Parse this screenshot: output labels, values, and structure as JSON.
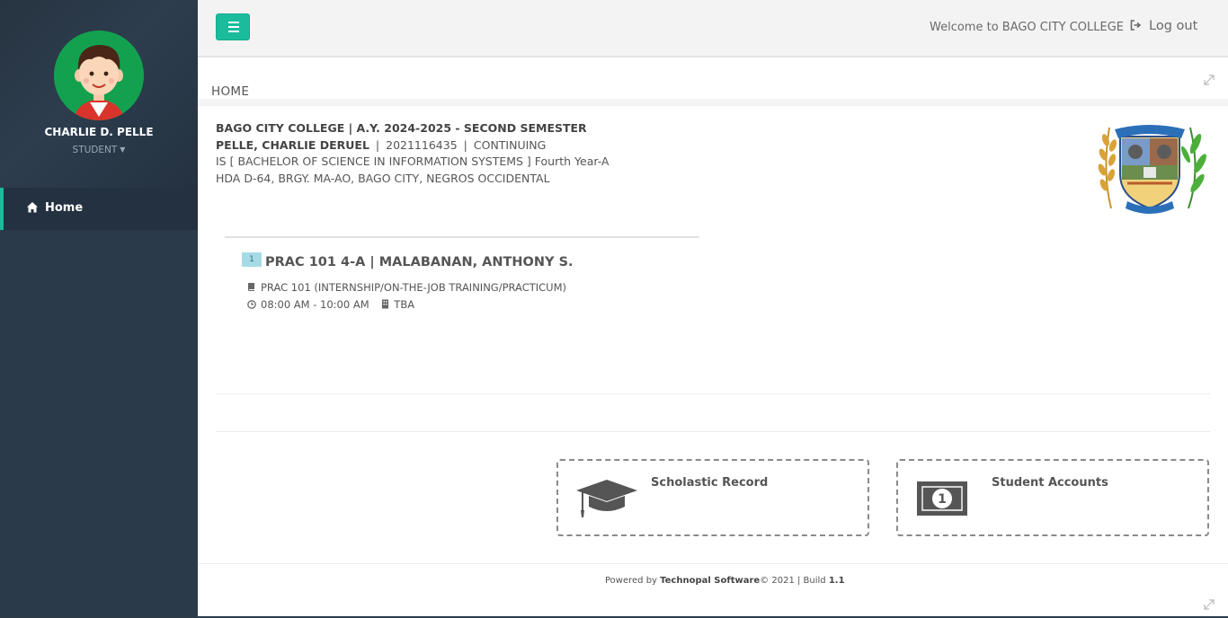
{
  "sidebar": {
    "profile_name": "CHARLIE D. PELLE",
    "profile_role": "STUDENT",
    "nav": [
      {
        "label": "Home",
        "icon": "home-icon",
        "active": true
      }
    ]
  },
  "topbar": {
    "menu_icon": "hamburger-menu-icon",
    "welcome": "Welcome to BAGO CITY COLLEGE",
    "logout_label": "Log out",
    "logout_icon": "sign-out-icon"
  },
  "page": {
    "title": "HOME"
  },
  "student": {
    "header": "BAGO CITY COLLEGE | A.Y. 2024-2025 - SECOND SEMESTER",
    "name": "PELLE, CHARLIE DERUEL",
    "student_id": "2021116435",
    "status": "CONTINUING",
    "program": "IS [ BACHELOR OF SCIENCE IN INFORMATION SYSTEMS ] Fourth Year-A",
    "address": "HDA D-64, BRGY. MA-AO, BAGO CITY, NEGROS OCCIDENTAL"
  },
  "schedule": [
    {
      "number": "1",
      "title": "PRAC 101  4-A | MALABANAN, ANTHONY S.",
      "description": "PRAC 101 (INTERNSHIP/ON-THE-JOB TRAINING/PRACTICUM)",
      "time": "08:00 AM - 10:00 AM",
      "room": "TBA"
    }
  ],
  "cards": [
    {
      "label": "Scholastic Record",
      "icon": "graduation-cap-icon"
    },
    {
      "label": "Student Accounts",
      "icon": "money-bill-icon"
    }
  ],
  "footer": {
    "prefix": "Powered by",
    "company": "Technopal Software",
    "year_text": "© 2021 | Build",
    "build": "1.1"
  },
  "colors": {
    "accent": "#1abc9c",
    "sidebar": "#2b3a4a",
    "topbar": "#f3f3f3"
  }
}
